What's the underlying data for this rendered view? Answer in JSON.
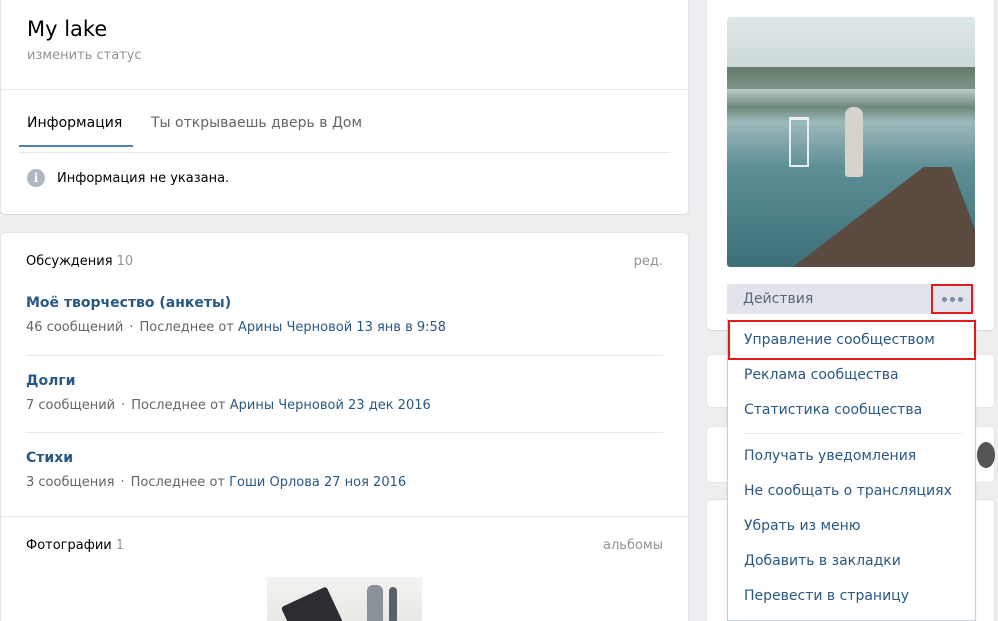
{
  "group": {
    "name": "My lake",
    "status_placeholder": "изменить статус"
  },
  "tabs": [
    {
      "label": "Информация"
    },
    {
      "label": "Ты открываешь дверь в Дом"
    }
  ],
  "info": {
    "icon": "info-icon",
    "icon_glyph": "i",
    "text": "Информация не указана."
  },
  "discussions": {
    "title": "Обсуждения",
    "count": "10",
    "edit_link": "ред.",
    "topics": [
      {
        "title": "Моё творчество (анкеты)",
        "messages": "46 сообщений",
        "dot": "·",
        "last_prefix": "Последнее от",
        "author_time": "Арины Черновой 13 янв в 9:58"
      },
      {
        "title": "Долги",
        "messages": "7 сообщений",
        "dot": "·",
        "last_prefix": "Последнее от",
        "author_time": "Арины Черновой 23 дек 2016"
      },
      {
        "title": "Стихи",
        "messages": "3 сообщения",
        "dot": "·",
        "last_prefix": "Последнее от",
        "author_time": "Гоши Орлова 27 ноя 2016"
      }
    ]
  },
  "photos": {
    "title": "Фотографии",
    "count": "1",
    "albums_link": "альбомы"
  },
  "actions": {
    "label": "Действия",
    "more_icon": "more-dots-icon"
  },
  "actions_menu": [
    {
      "label": "Управление сообществом"
    },
    {
      "label": "Реклама сообщества"
    },
    {
      "label": "Статистика сообщества"
    },
    {
      "label": "Получать уведомления"
    },
    {
      "label": "Не сообщать о трансляциях"
    },
    {
      "label": "Убрать из меню"
    },
    {
      "label": "Добавить в закладки"
    },
    {
      "label": "Перевести в страницу"
    }
  ],
  "colors": {
    "link": "#2a5885",
    "accent": "#5181b8",
    "highlight_border": "#e21b1b",
    "background": "#edeef0"
  }
}
